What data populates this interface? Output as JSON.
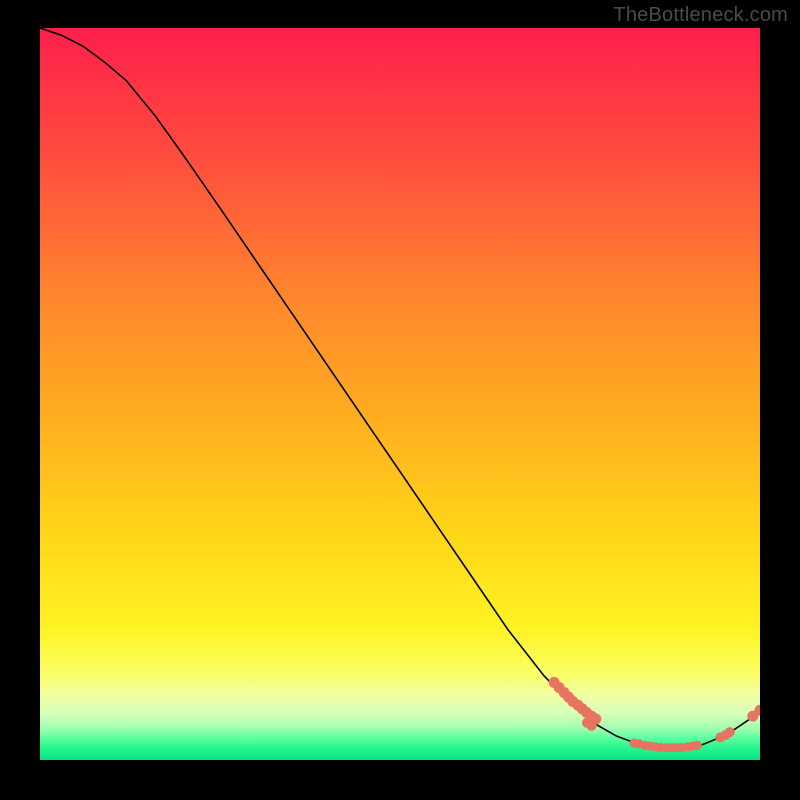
{
  "watermark": "TheBottleneck.com",
  "colors": {
    "marker": "#e77461",
    "curve": "#000000"
  },
  "chart_data": {
    "type": "line",
    "title": "",
    "xlabel": "",
    "ylabel": "",
    "xlim": [
      0,
      100
    ],
    "ylim": [
      0,
      100
    ],
    "grid": false,
    "legend": false,
    "curve": [
      {
        "x": 0.0,
        "y": 100.0
      },
      {
        "x": 3.0,
        "y": 99.0
      },
      {
        "x": 6.0,
        "y": 97.5
      },
      {
        "x": 9.0,
        "y": 95.3
      },
      {
        "x": 12.0,
        "y": 92.8
      },
      {
        "x": 16.0,
        "y": 88.0
      },
      {
        "x": 20.0,
        "y": 82.5
      },
      {
        "x": 25.0,
        "y": 75.4
      },
      {
        "x": 30.0,
        "y": 68.2
      },
      {
        "x": 35.0,
        "y": 61.0
      },
      {
        "x": 40.0,
        "y": 53.8
      },
      {
        "x": 45.0,
        "y": 46.6
      },
      {
        "x": 50.0,
        "y": 39.4
      },
      {
        "x": 55.0,
        "y": 32.2
      },
      {
        "x": 60.0,
        "y": 25.0
      },
      {
        "x": 65.0,
        "y": 17.8
      },
      {
        "x": 70.0,
        "y": 11.5
      },
      {
        "x": 74.0,
        "y": 7.5
      },
      {
        "x": 77.0,
        "y": 5.0
      },
      {
        "x": 80.0,
        "y": 3.3
      },
      {
        "x": 83.0,
        "y": 2.2
      },
      {
        "x": 86.0,
        "y": 1.7
      },
      {
        "x": 89.0,
        "y": 1.6
      },
      {
        "x": 92.0,
        "y": 2.1
      },
      {
        "x": 94.5,
        "y": 3.1
      },
      {
        "x": 96.5,
        "y": 4.2
      },
      {
        "x": 98.3,
        "y": 5.4
      },
      {
        "x": 100.0,
        "y": 6.8
      }
    ],
    "markers_cluster_a": [
      {
        "x": 71.4,
        "y": 10.6
      },
      {
        "x": 72.1,
        "y": 9.9
      },
      {
        "x": 72.8,
        "y": 9.2
      },
      {
        "x": 73.4,
        "y": 8.6
      },
      {
        "x": 74.0,
        "y": 8.0
      },
      {
        "x": 74.7,
        "y": 7.5
      },
      {
        "x": 75.3,
        "y": 7.0
      },
      {
        "x": 75.9,
        "y": 6.5
      },
      {
        "x": 76.6,
        "y": 6.0
      },
      {
        "x": 77.2,
        "y": 5.6
      }
    ],
    "markers_cluster_a_pair": [
      {
        "x": 76.0,
        "y": 5.1
      },
      {
        "x": 76.6,
        "y": 4.7
      }
    ],
    "markers_valley": [
      {
        "x": 82.5,
        "y": 2.3
      },
      {
        "x": 83.2,
        "y": 2.2
      },
      {
        "x": 84.0,
        "y": 2.0
      },
      {
        "x": 84.8,
        "y": 1.9
      },
      {
        "x": 85.5,
        "y": 1.8
      },
      {
        "x": 86.2,
        "y": 1.7
      },
      {
        "x": 87.0,
        "y": 1.7
      },
      {
        "x": 87.7,
        "y": 1.7
      },
      {
        "x": 88.4,
        "y": 1.7
      },
      {
        "x": 89.1,
        "y": 1.7
      },
      {
        "x": 89.9,
        "y": 1.8
      },
      {
        "x": 90.6,
        "y": 1.9
      },
      {
        "x": 91.3,
        "y": 2.0
      }
    ],
    "markers_right": [
      {
        "x": 94.5,
        "y": 3.1
      },
      {
        "x": 95.2,
        "y": 3.4
      },
      {
        "x": 95.8,
        "y": 3.8
      }
    ],
    "markers_far_right": [
      {
        "x": 99.0,
        "y": 6.0
      },
      {
        "x": 100.0,
        "y": 6.8
      }
    ]
  }
}
